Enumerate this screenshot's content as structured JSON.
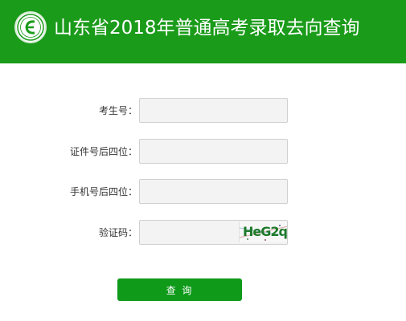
{
  "header": {
    "title": "山东省2018年普通高考录取去向查询",
    "logo_icon": "exam-e-logo-icon",
    "background_color": "#1a9b1a"
  },
  "form": {
    "exam_number": {
      "label": "考生号：",
      "value": ""
    },
    "id_last4": {
      "label": "证件号后四位：",
      "value": ""
    },
    "phone_last4": {
      "label": "手机号后四位：",
      "value": ""
    },
    "captcha": {
      "label": "验证码：",
      "value": "",
      "image_text": "HeG2q"
    }
  },
  "actions": {
    "submit_label": "查 询",
    "submit_color": "#0f9a1a"
  }
}
